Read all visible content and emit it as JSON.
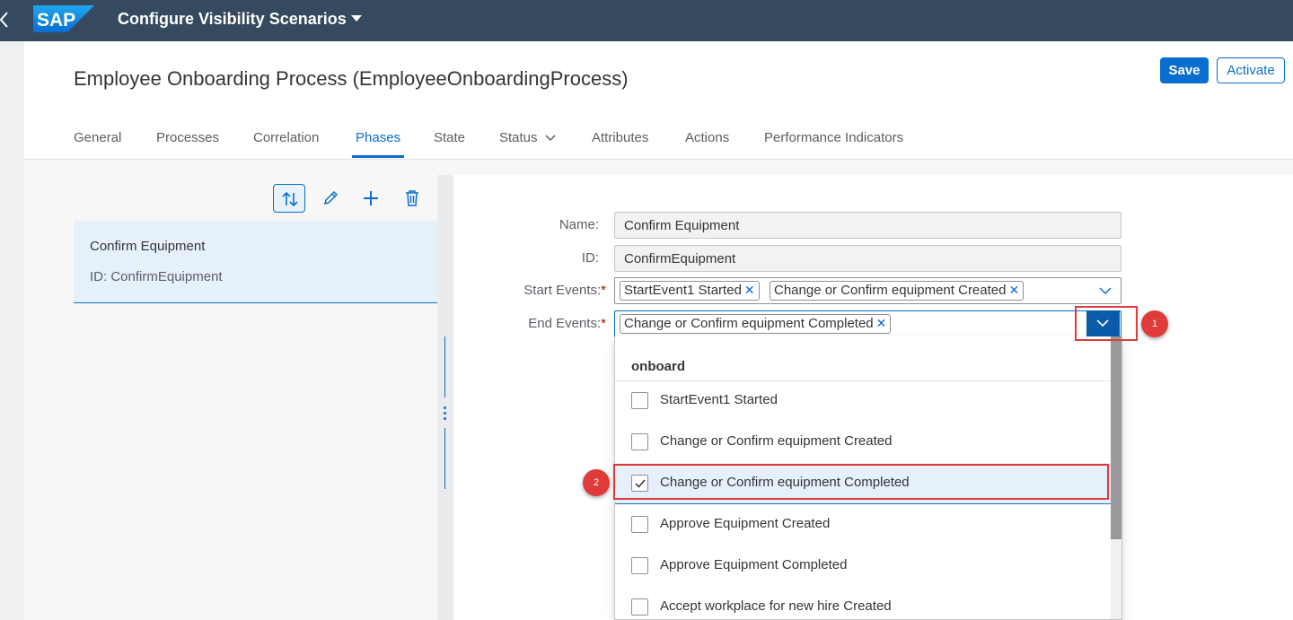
{
  "shell": {
    "title": "Configure Visibility Scenarios",
    "logo_text": "SAP"
  },
  "header": {
    "title": "Employee Onboarding Process (EmployeeOnboardingProcess)",
    "save_label": "Save",
    "activate_label": "Activate",
    "tabs": [
      "General",
      "Processes",
      "Correlation",
      "Phases",
      "State",
      "Status",
      "Attributes",
      "Actions",
      "Performance Indicators"
    ],
    "active_tab": "Phases"
  },
  "master": {
    "items": [
      {
        "title": "Confirm Equipment",
        "id_text": "ID: ConfirmEquipment"
      }
    ]
  },
  "form": {
    "name_label": "Name:",
    "name_value": "Confirm Equipment",
    "id_label": "ID:",
    "id_value": "ConfirmEquipment",
    "start_label": "Start Events:",
    "start_tokens": [
      "StartEvent1 Started",
      "Change or Confirm equipment Created"
    ],
    "end_label": "End Events:",
    "end_tokens": [
      "Change or Confirm equipment Completed"
    ],
    "required_mark": "*"
  },
  "dropdown": {
    "group": "onboard",
    "options": [
      {
        "label": "StartEvent1 Started",
        "checked": false
      },
      {
        "label": "Change or Confirm equipment Created",
        "checked": false
      },
      {
        "label": "Change or Confirm equipment Completed",
        "checked": true
      },
      {
        "label": "Approve Equipment Created",
        "checked": false
      },
      {
        "label": "Approve Equipment Completed",
        "checked": false
      },
      {
        "label": "Accept workplace for new hire Created",
        "checked": false
      }
    ]
  },
  "annotations": {
    "badge1": "1",
    "badge2": "2"
  },
  "colors": {
    "shell": "#354a5f",
    "accent": "#0a6ed1",
    "highlight": "#e03b3b",
    "selected_bg": "#e5f0fa"
  },
  "icons": [
    "back-icon",
    "sort-icon",
    "edit-icon",
    "add-icon",
    "delete-icon",
    "chevron-down-icon",
    "close-icon",
    "checkmark-icon"
  ]
}
